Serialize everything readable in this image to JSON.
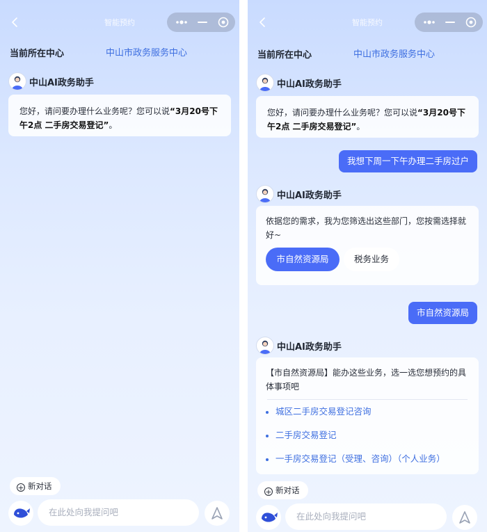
{
  "header": {
    "title": "智能预约",
    "capsule_dots": "•●•"
  },
  "center": {
    "label": "当前所在中心",
    "value": "中山市政务服务中心"
  },
  "assistant": {
    "name": "中山AI政务助手"
  },
  "greeting": {
    "text_prefix": "您好，请问要办理什么业务呢？您可以说",
    "text_bold": "“3月20号下午2点 二手房交易登记”",
    "text_suffix": "。"
  },
  "user_messages": [
    "我想下周一下午办理二手房过户",
    "市自然资源局"
  ],
  "reply_departments": {
    "text": "依据您的需求，我为您筛选出这些部门，您按需选择就好~",
    "options": [
      "市自然资源局",
      "税务业务"
    ]
  },
  "reply_services": {
    "text": "【市自然资源局】能办这些业务，选一选您想预约的具体事项吧",
    "items": [
      "城区二手房交易登记咨询",
      "二手房交易登记",
      "一手房交易登记（受理、咨询）（个人业务）"
    ]
  },
  "new_chat": {
    "label": "新对话"
  },
  "input": {
    "placeholder": "在此处向我提问吧"
  },
  "colors": {
    "accent": "#4a6cf7",
    "link": "#3e6fe0"
  }
}
